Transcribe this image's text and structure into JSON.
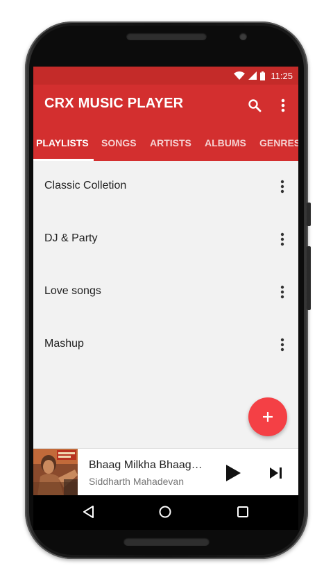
{
  "status_bar": {
    "time": "11:25",
    "icons": [
      "wifi-icon",
      "signal-icon",
      "battery-icon"
    ]
  },
  "app_bar": {
    "title": "CRX MUSIC PLAYER",
    "actions": [
      "search-icon",
      "overflow-menu-icon"
    ]
  },
  "tabs": [
    {
      "label": "PLAYLISTS",
      "active": true
    },
    {
      "label": "SONGS",
      "active": false
    },
    {
      "label": "ARTISTS",
      "active": false
    },
    {
      "label": "ALBUMS",
      "active": false
    },
    {
      "label": "GENRES",
      "active": false
    }
  ],
  "playlists": [
    {
      "label": "Classic Colletion"
    },
    {
      "label": "DJ & Party"
    },
    {
      "label": "Love songs"
    },
    {
      "label": "Mashup"
    }
  ],
  "fab": {
    "icon": "plus-icon"
  },
  "now_playing": {
    "title": "Bhaag Milkha Bhaag…",
    "artist": "Siddharth Mahadevan",
    "controls": [
      "play-icon",
      "skip-next-icon"
    ]
  },
  "nav_bar": {
    "icons": [
      "back-icon",
      "home-icon",
      "recents-icon"
    ]
  },
  "colors": {
    "status_bar": "#c42b29",
    "app_bar": "#d32f2f",
    "fab": "#f44045",
    "background": "#f2f2f2"
  }
}
